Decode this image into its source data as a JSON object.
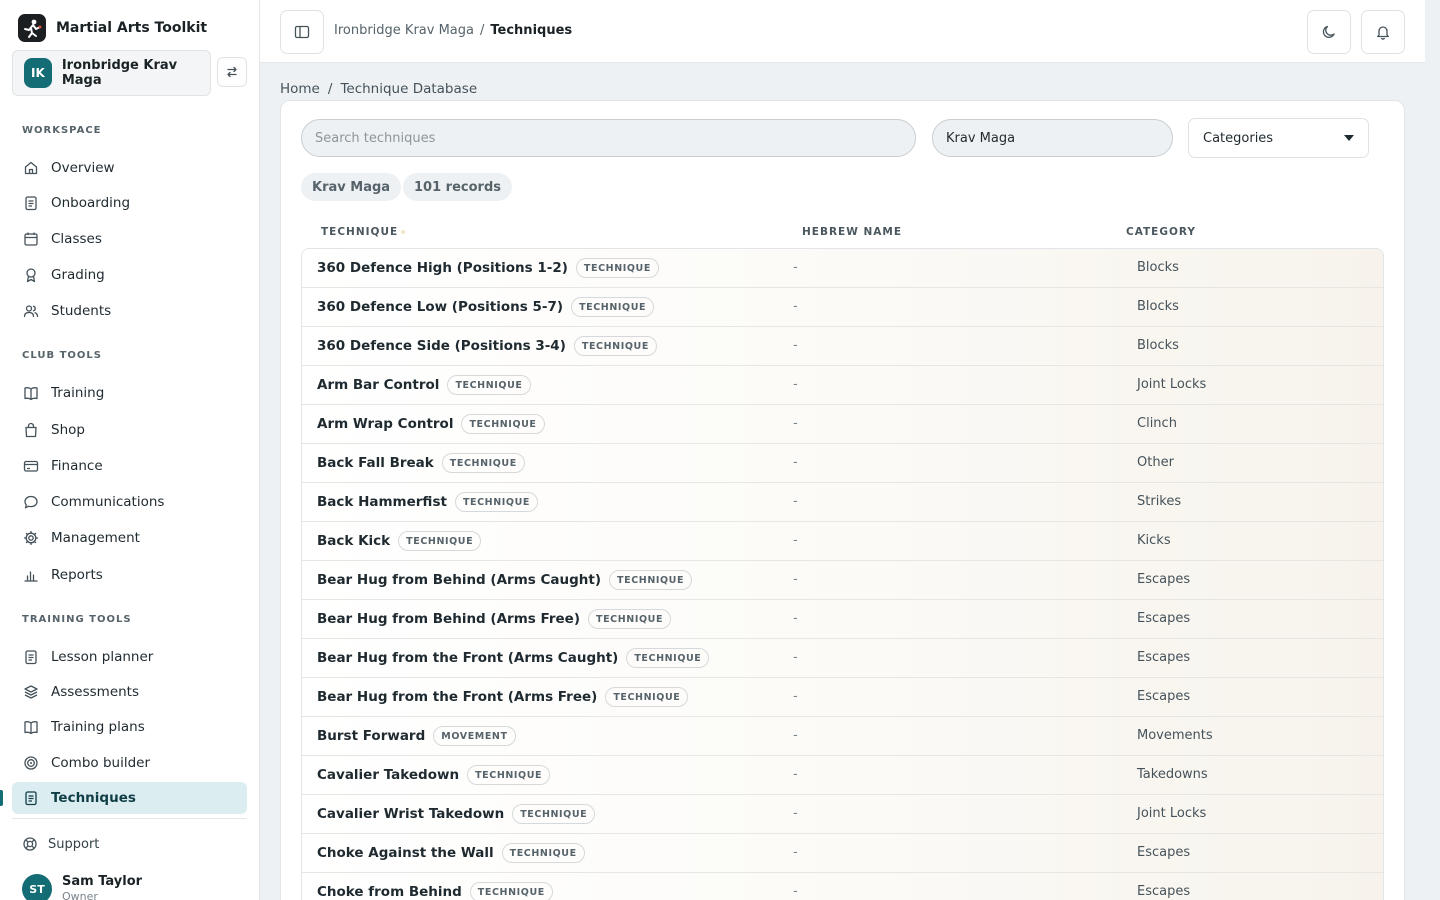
{
  "app": {
    "name": "Martial Arts Toolkit"
  },
  "club": {
    "initials": "IK",
    "name": "Ironbridge Krav Maga"
  },
  "sidebar": {
    "workspace_label": "WORKSPACE",
    "club_tools_label": "CLUB TOOLS",
    "training_tools_label": "TRAINING TOOLS",
    "workspace": [
      {
        "label": "Overview",
        "icon": "home-icon"
      },
      {
        "label": "Onboarding",
        "icon": "clipboard-icon"
      },
      {
        "label": "Classes",
        "icon": "calendar-icon"
      },
      {
        "label": "Grading",
        "icon": "award-icon"
      },
      {
        "label": "Students",
        "icon": "users-icon"
      }
    ],
    "club_tools": [
      {
        "label": "Training",
        "icon": "book-icon"
      },
      {
        "label": "Shop",
        "icon": "shopping-bag-icon"
      },
      {
        "label": "Finance",
        "icon": "credit-card-icon"
      },
      {
        "label": "Communications",
        "icon": "chat-icon"
      },
      {
        "label": "Management",
        "icon": "gear-icon"
      },
      {
        "label": "Reports",
        "icon": "bar-chart-icon"
      }
    ],
    "training_tools": [
      {
        "label": "Lesson planner",
        "icon": "clipboard-icon"
      },
      {
        "label": "Assessments",
        "icon": "layers-icon"
      },
      {
        "label": "Training plans",
        "icon": "book-icon"
      },
      {
        "label": "Combo builder",
        "icon": "target-icon"
      },
      {
        "label": "Techniques",
        "icon": "clipboard-icon",
        "active": true
      }
    ],
    "support_label": "Support",
    "user": {
      "initials": "ST",
      "name": "Sam Taylor",
      "role": "Owner"
    }
  },
  "topbar": {
    "breadcrumb": {
      "club": "Ironbridge Krav Maga",
      "separator": "/",
      "current": "Techniques"
    }
  },
  "page_breadcrumb": {
    "home": "Home",
    "separator": "/",
    "current": "Technique Database"
  },
  "filters": {
    "search_placeholder": "Search techniques",
    "style_value": "Krav Maga",
    "category_label": "Categories"
  },
  "chips": {
    "style": "Krav Maga",
    "count": "101 records"
  },
  "table": {
    "columns": {
      "technique": "TECHNIQUE",
      "hebrew": "HEBREW NAME",
      "category": "CATEGORY"
    },
    "rows": [
      {
        "name": "360 Defence High (Positions 1-2)",
        "tag": "TECHNIQUE",
        "hebrew": "-",
        "category": "Blocks"
      },
      {
        "name": "360 Defence Low (Positions 5-7)",
        "tag": "TECHNIQUE",
        "hebrew": "-",
        "category": "Blocks"
      },
      {
        "name": "360 Defence Side (Positions 3-4)",
        "tag": "TECHNIQUE",
        "hebrew": "-",
        "category": "Blocks"
      },
      {
        "name": "Arm Bar Control",
        "tag": "TECHNIQUE",
        "hebrew": "-",
        "category": "Joint Locks"
      },
      {
        "name": "Arm Wrap Control",
        "tag": "TECHNIQUE",
        "hebrew": "-",
        "category": "Clinch"
      },
      {
        "name": "Back Fall Break",
        "tag": "TECHNIQUE",
        "hebrew": "-",
        "category": "Other"
      },
      {
        "name": "Back Hammerfist",
        "tag": "TECHNIQUE",
        "hebrew": "-",
        "category": "Strikes"
      },
      {
        "name": "Back Kick",
        "tag": "TECHNIQUE",
        "hebrew": "-",
        "category": "Kicks"
      },
      {
        "name": "Bear Hug from Behind (Arms Caught)",
        "tag": "TECHNIQUE",
        "hebrew": "-",
        "category": "Escapes"
      },
      {
        "name": "Bear Hug from Behind (Arms Free)",
        "tag": "TECHNIQUE",
        "hebrew": "-",
        "category": "Escapes"
      },
      {
        "name": "Bear Hug from the Front (Arms Caught)",
        "tag": "TECHNIQUE",
        "hebrew": "-",
        "category": "Escapes"
      },
      {
        "name": "Bear Hug from the Front (Arms Free)",
        "tag": "TECHNIQUE",
        "hebrew": "-",
        "category": "Escapes"
      },
      {
        "name": "Burst Forward",
        "tag": "MOVEMENT",
        "hebrew": "-",
        "category": "Movements"
      },
      {
        "name": "Cavalier Takedown",
        "tag": "TECHNIQUE",
        "hebrew": "-",
        "category": "Takedowns"
      },
      {
        "name": "Cavalier Wrist Takedown",
        "tag": "TECHNIQUE",
        "hebrew": "-",
        "category": "Joint Locks"
      },
      {
        "name": "Choke Against the Wall",
        "tag": "TECHNIQUE",
        "hebrew": "-",
        "category": "Escapes"
      },
      {
        "name": "Choke from Behind",
        "tag": "TECHNIQUE",
        "hebrew": "-",
        "category": "Escapes"
      }
    ]
  },
  "colors": {
    "accent": "#146c74",
    "active_bg": "#dcedf1",
    "row_tint": "#f7f3ec"
  }
}
